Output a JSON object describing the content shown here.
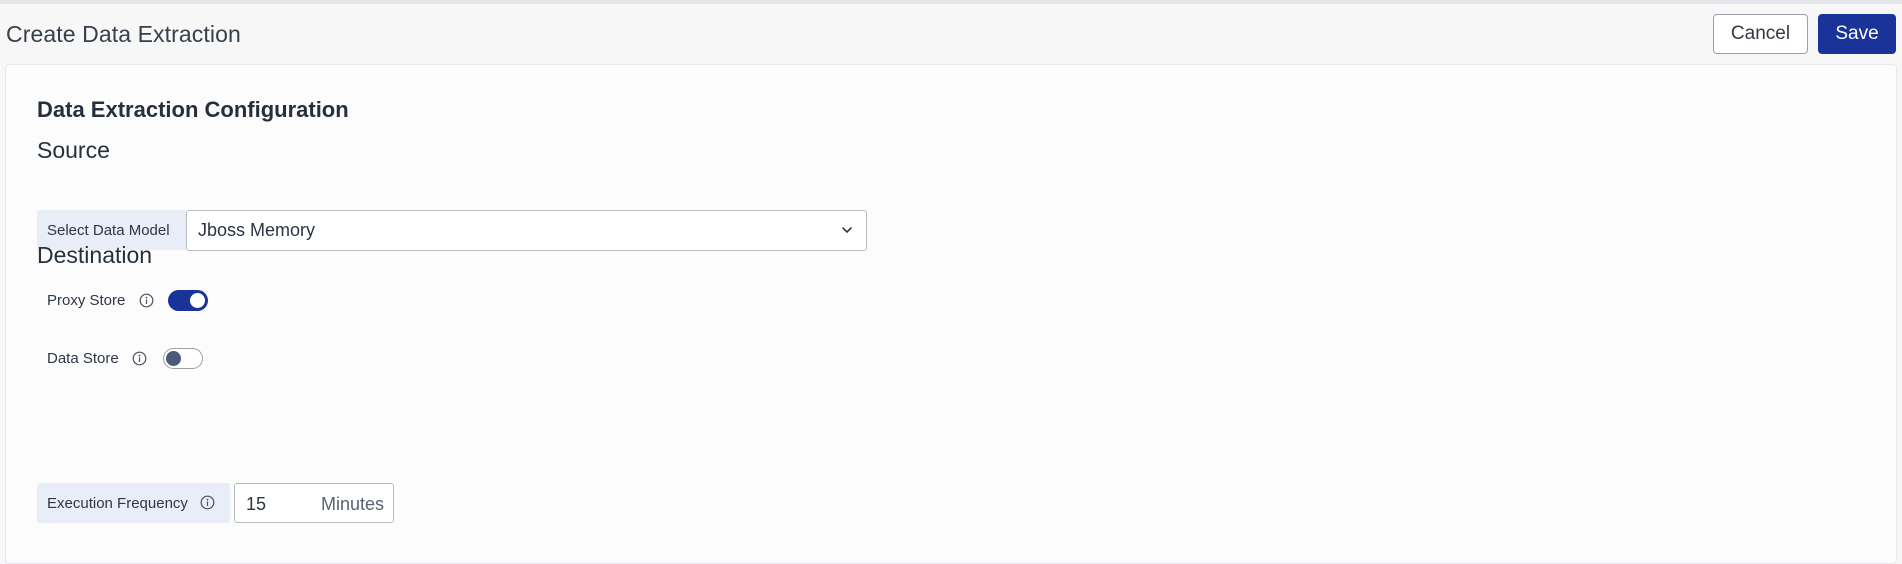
{
  "header": {
    "title": "Create Data Extraction",
    "cancel_label": "Cancel",
    "save_label": "Save"
  },
  "config": {
    "title": "Data Extraction Configuration",
    "source": {
      "heading": "Source",
      "data_model_label": "Select Data Model",
      "data_model_value": "Jboss Memory"
    },
    "destination": {
      "heading": "Destination",
      "proxy_store_label": "Proxy Store",
      "proxy_store_enabled": true,
      "data_store_label": "Data Store",
      "data_store_enabled": false,
      "execution_frequency_label": "Execution Frequency",
      "execution_frequency_value": "15",
      "execution_frequency_unit": "Minutes"
    }
  },
  "colors": {
    "primary": "#1a3399",
    "label_bg": "#e9edf7"
  },
  "icons": {
    "select_chevron": "chevron-down-icon",
    "info": "info-icon"
  }
}
